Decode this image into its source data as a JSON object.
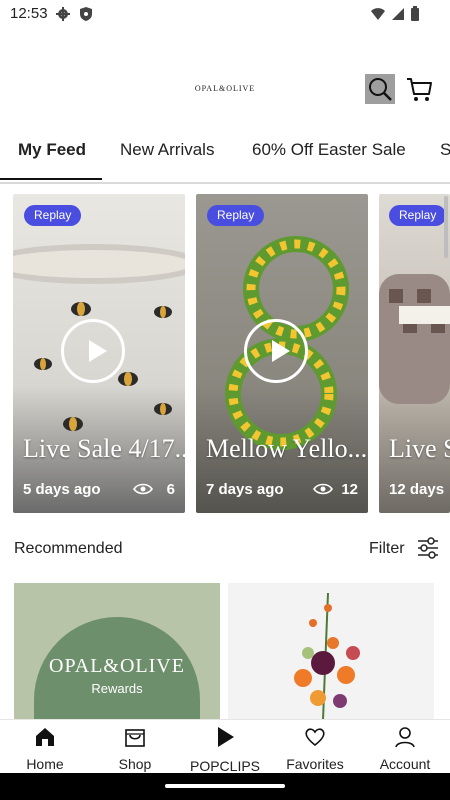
{
  "status_bar": {
    "time": "12:53"
  },
  "header": {
    "brand": "OPAL&OLIVE"
  },
  "tabs": [
    {
      "label": "My Feed",
      "active": true
    },
    {
      "label": "New Arrivals",
      "active": false
    },
    {
      "label": "60% Off Easter Sale",
      "active": false
    },
    {
      "label": "S",
      "active": false
    }
  ],
  "videos": [
    {
      "badge": "Replay",
      "title": "Live Sale 4/17..",
      "age": "5 days ago",
      "views": "6"
    },
    {
      "badge": "Replay",
      "title": "Mellow Yello...",
      "age": "7 days ago",
      "views": "12"
    },
    {
      "badge": "Replay",
      "title": "Live S",
      "age": "12 days",
      "views": ""
    }
  ],
  "recommended": {
    "title": "Recommended",
    "filter_label": "Filter",
    "products": [
      {
        "brand": "OPAL&OLIVE",
        "subtitle": "Rewards"
      },
      {
        "brand": "",
        "subtitle": ""
      }
    ]
  },
  "bottom_nav": [
    {
      "label": "Home",
      "icon": "home-icon"
    },
    {
      "label": "Shop",
      "icon": "shopping-bag-icon"
    },
    {
      "label": "POPCLIPS",
      "icon": "play-icon"
    },
    {
      "label": "Favorites",
      "icon": "heart-icon"
    },
    {
      "label": "Account",
      "icon": "person-icon"
    }
  ],
  "colors": {
    "badge": "#4a4ee0",
    "accent": "#111111",
    "rewards_green": "#6e8f6b"
  }
}
